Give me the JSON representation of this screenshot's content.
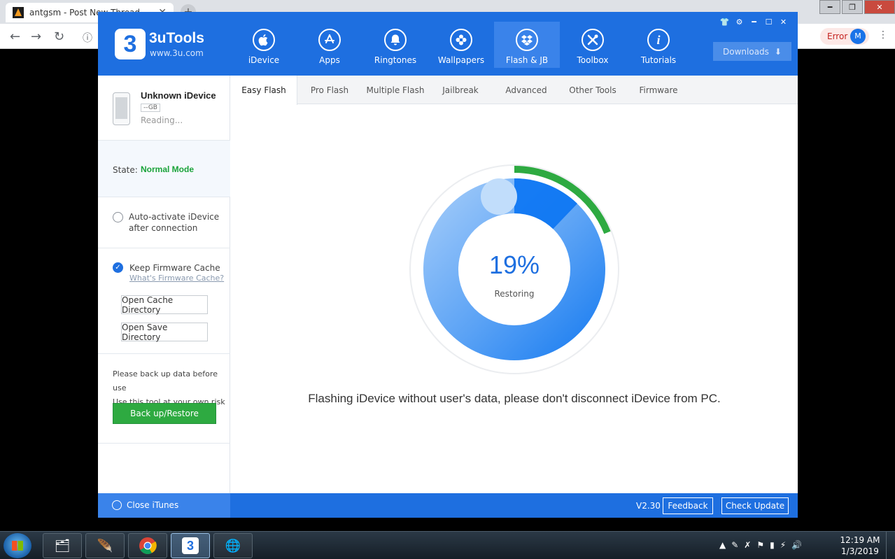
{
  "browser": {
    "tab_title": "antgsm - Post New Thread",
    "tab_close": "✕",
    "new_tab": "+",
    "error_label": "Error",
    "avatar_initial": "M"
  },
  "app": {
    "brand": "3uTools",
    "brand_url": "www.3u.com",
    "logo_char": "3",
    "nav": [
      {
        "label": "iDevice",
        "icon": "apple-icon"
      },
      {
        "label": "Apps",
        "icon": "app-store-icon"
      },
      {
        "label": "Ringtones",
        "icon": "bell-icon"
      },
      {
        "label": "Wallpapers",
        "icon": "flower-icon"
      },
      {
        "label": "Flash & JB",
        "icon": "dropbox-icon"
      },
      {
        "label": "Toolbox",
        "icon": "tools-icon"
      },
      {
        "label": "Tutorials",
        "icon": "info-icon"
      }
    ],
    "active_nav": "Flash & JB",
    "downloads_label": "Downloads"
  },
  "sidebar": {
    "device_name": "Unknown iDevice",
    "device_capacity": "--GB",
    "device_status": "Reading...",
    "state_label": "State:",
    "state_value": "Normal Mode",
    "auto_activate": "Auto-activate iDevice after connection",
    "keep_cache": "Keep Firmware Cache",
    "cache_link": "What's Firmware Cache?",
    "open_cache": "Open Cache Directory",
    "open_save": "Open Save Directory",
    "backup_note_1": "Please back up data before use",
    "backup_note_2": "Use this tool at your own risk",
    "backup_button": "Back up/Restore"
  },
  "subtabs": [
    "Easy Flash",
    "Pro Flash",
    "Multiple Flash",
    "Jailbreak",
    "Advanced",
    "Other Tools",
    "Firmware"
  ],
  "active_subtab": "Easy Flash",
  "progress": {
    "percent_label": "19%",
    "value": 0.19,
    "status": "Restoring",
    "message": "Flashing iDevice without user's data, please don't disconnect iDevice from PC.",
    "colors": {
      "progress": "#2eaa41",
      "ring_light": "#a9cffa",
      "ring_dark": "#1278f0"
    }
  },
  "footer": {
    "close_itunes": "Close iTunes",
    "version": "V2.30",
    "feedback": "Feedback",
    "check_update": "Check Update"
  },
  "taskbar": {
    "time": "12:19 AM",
    "date": "1/3/2019"
  }
}
